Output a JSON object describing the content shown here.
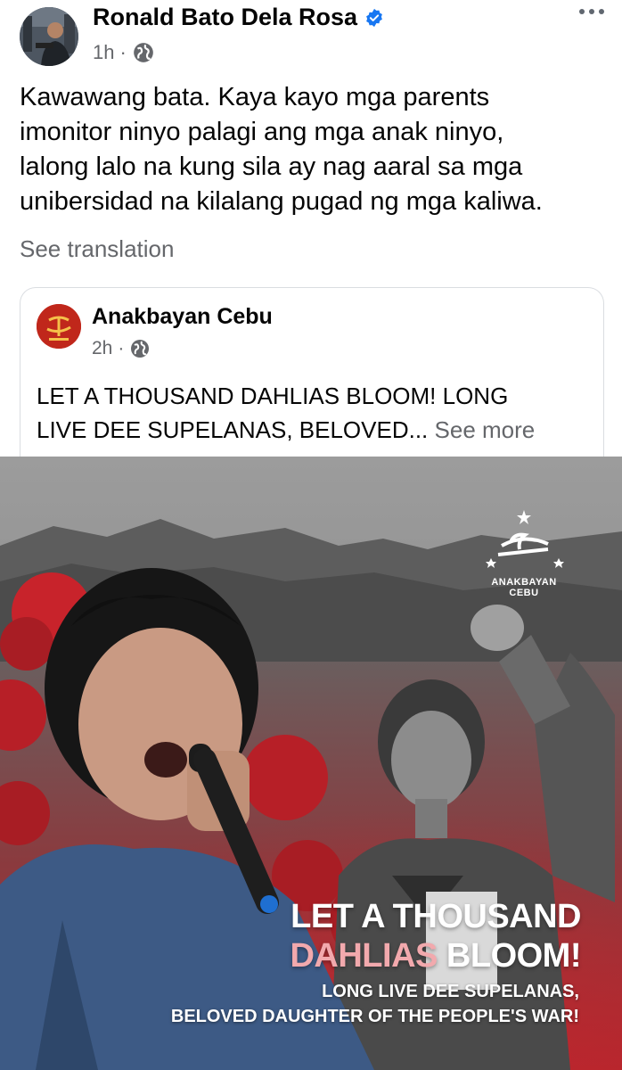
{
  "post": {
    "author": "Ronald Bato Dela Rosa",
    "time": "1h",
    "dot": "·",
    "text_lines": [
      "Kawawang bata. Kaya kayo mga parents",
      "imonitor ninyo palagi ang mga anak ninyo,",
      "lalong lalo na kung sila ay nag aaral sa mga",
      "unibersidad na kilalang pugad ng mga kaliwa."
    ],
    "see_translation": "See translation"
  },
  "shared": {
    "page_name": "Anakbayan Cebu",
    "time": "2h",
    "dot": "·",
    "text_line1": "LET A THOUSAND DAHLIAS BLOOM! LONG",
    "text_line2": "LIVE DEE SUPELANAS, BELOVED...",
    "see_more": "See more"
  },
  "poster": {
    "logo_text": "ANAKBAYAN CEBU",
    "headline_line1": "LET A THOUSAND",
    "headline_pink": "DAHLIAS",
    "headline_rest": " BLOOM!",
    "sub_line1": "LONG LIVE DEE SUPELANAS,",
    "sub_line2": "BELOVED DAUGHTER OF THE PEOPLE'S WAR!"
  },
  "colors": {
    "verified": "#1877f2",
    "secondary_text": "#65676b",
    "poster_red": "#a3242a",
    "headline_pink": "#f2a9ad"
  },
  "icons": [
    "verified-badge-icon",
    "globe-icon",
    "more-options-icon",
    "anakbayan-logo"
  ]
}
